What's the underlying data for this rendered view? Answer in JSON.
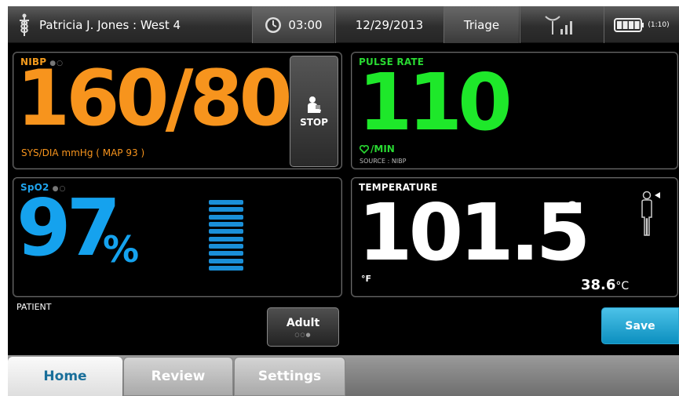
{
  "status_bar": {
    "patient": "Patricia J. Jones : West 4",
    "clock": "03:00",
    "date": "12/29/2013",
    "profile": "Triage",
    "battery_time": "(1:10)"
  },
  "nibp": {
    "label": "NIBP",
    "value": "160/80",
    "units": "SYS/DIA  mmHg  ( MAP 93 )",
    "stop_label": "STOP"
  },
  "pulse": {
    "label": "PULSE RATE",
    "value": "110",
    "units": "/MIN",
    "source": "SOURCE : NIBP"
  },
  "spo2": {
    "label": "SpO2",
    "value": "97",
    "unit": "%",
    "pleth_level": 10
  },
  "temperature": {
    "label": "TEMPERATURE",
    "value": "101.5",
    "degree": "°",
    "unit_f": "°F",
    "celsius_value": "38.6",
    "celsius_unit": "°C"
  },
  "patient": {
    "label": "PATIENT",
    "mode_button": "Adult"
  },
  "actions": {
    "save": "Save"
  },
  "tabs": [
    {
      "label": "Home"
    },
    {
      "label": "Review"
    },
    {
      "label": "Settings"
    }
  ],
  "colors": {
    "nibp": "#f7941d",
    "pulse": "#1ee82a",
    "spo2": "#15a2ee",
    "save": "#1a9fd0",
    "home_tab_text": "#1a6f9a"
  },
  "icons": {
    "status": [
      "caduceus-icon",
      "clock-icon",
      "signal-antenna-icon",
      "battery-icon"
    ],
    "nibp_stop": "patient-cuff-icon",
    "pulse": "heart-icon",
    "temperature": "patient-body-icon"
  }
}
